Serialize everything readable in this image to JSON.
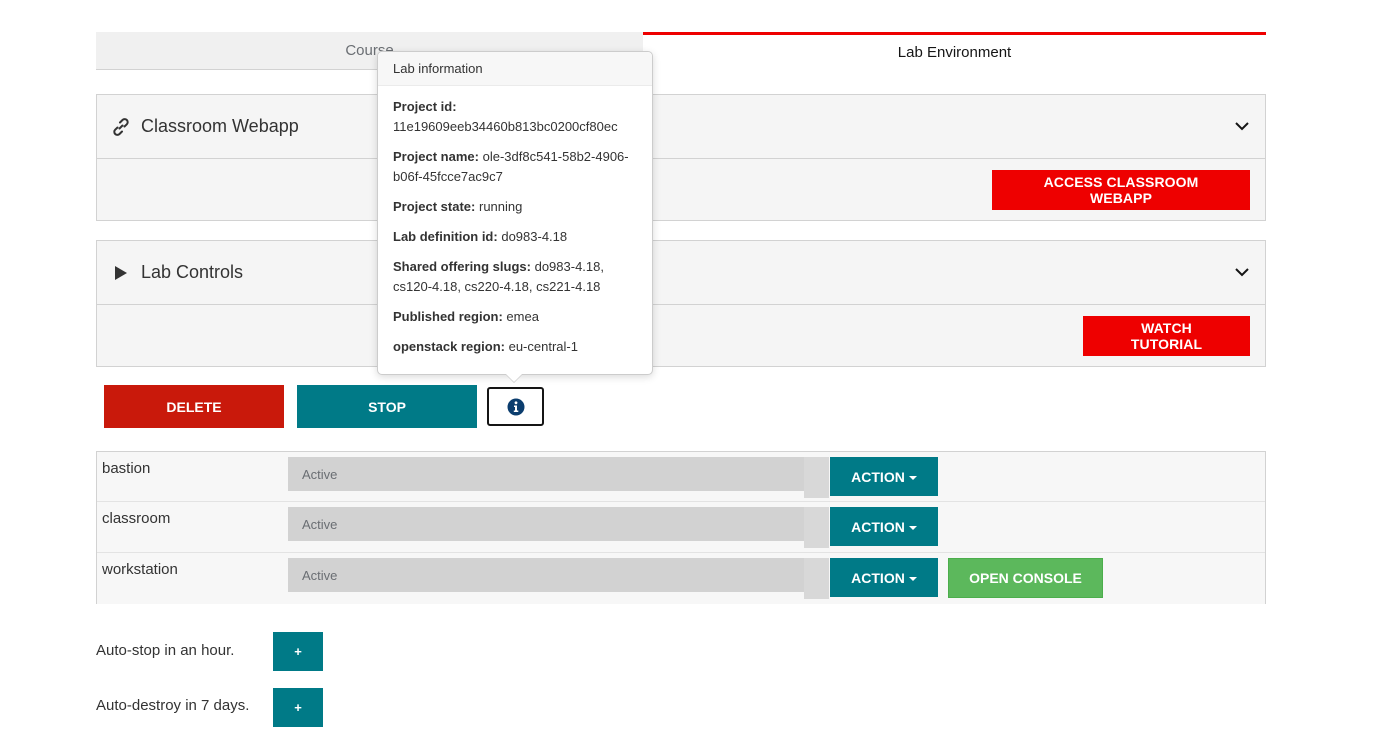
{
  "tabs": {
    "course": "Course",
    "lab_environment": "Lab Environment"
  },
  "webapp_panel": {
    "title": "Classroom Webapp",
    "icon": "link-icon",
    "button": "ACCESS CLASSROOM WEBAPP"
  },
  "controls_panel": {
    "title": "Lab Controls",
    "icon": "play-icon",
    "button": "WATCH TUTORIAL"
  },
  "actions": {
    "delete": "DELETE",
    "stop": "STOP",
    "info_icon": "info-circle-icon"
  },
  "popover": {
    "title": "Lab information",
    "items": [
      {
        "label": "Project id:",
        "value": "11e19609eeb34460b813bc0200cf80ec"
      },
      {
        "label": "Project name:",
        "value": "ole-3df8c541-58b2-4906-b06f-45fcce7ac9c7"
      },
      {
        "label": "Project state:",
        "value": "running"
      },
      {
        "label": "Lab definition id:",
        "value": "do983-4.18"
      },
      {
        "label": "Shared offering slugs:",
        "value": "do983-4.18, cs120-4.18, cs220-4.18, cs221-4.18"
      },
      {
        "label": "Published region:",
        "value": "emea"
      },
      {
        "label": "openstack region:",
        "value": "eu-central-1"
      }
    ]
  },
  "vms": [
    {
      "name": "bastion",
      "status": "Active",
      "action": "ACTION"
    },
    {
      "name": "classroom",
      "status": "Active",
      "action": "ACTION"
    },
    {
      "name": "workstation",
      "status": "Active",
      "action": "ACTION",
      "console": "OPEN CONSOLE"
    }
  ],
  "auto": {
    "stop_label": "Auto-stop in an hour.",
    "destroy_label": "Auto-destroy in 7 days.",
    "plus": "+"
  },
  "colors": {
    "red": "#ee0000",
    "dark_red": "#c9190b",
    "teal": "#007a87",
    "green": "#5cb85c"
  }
}
